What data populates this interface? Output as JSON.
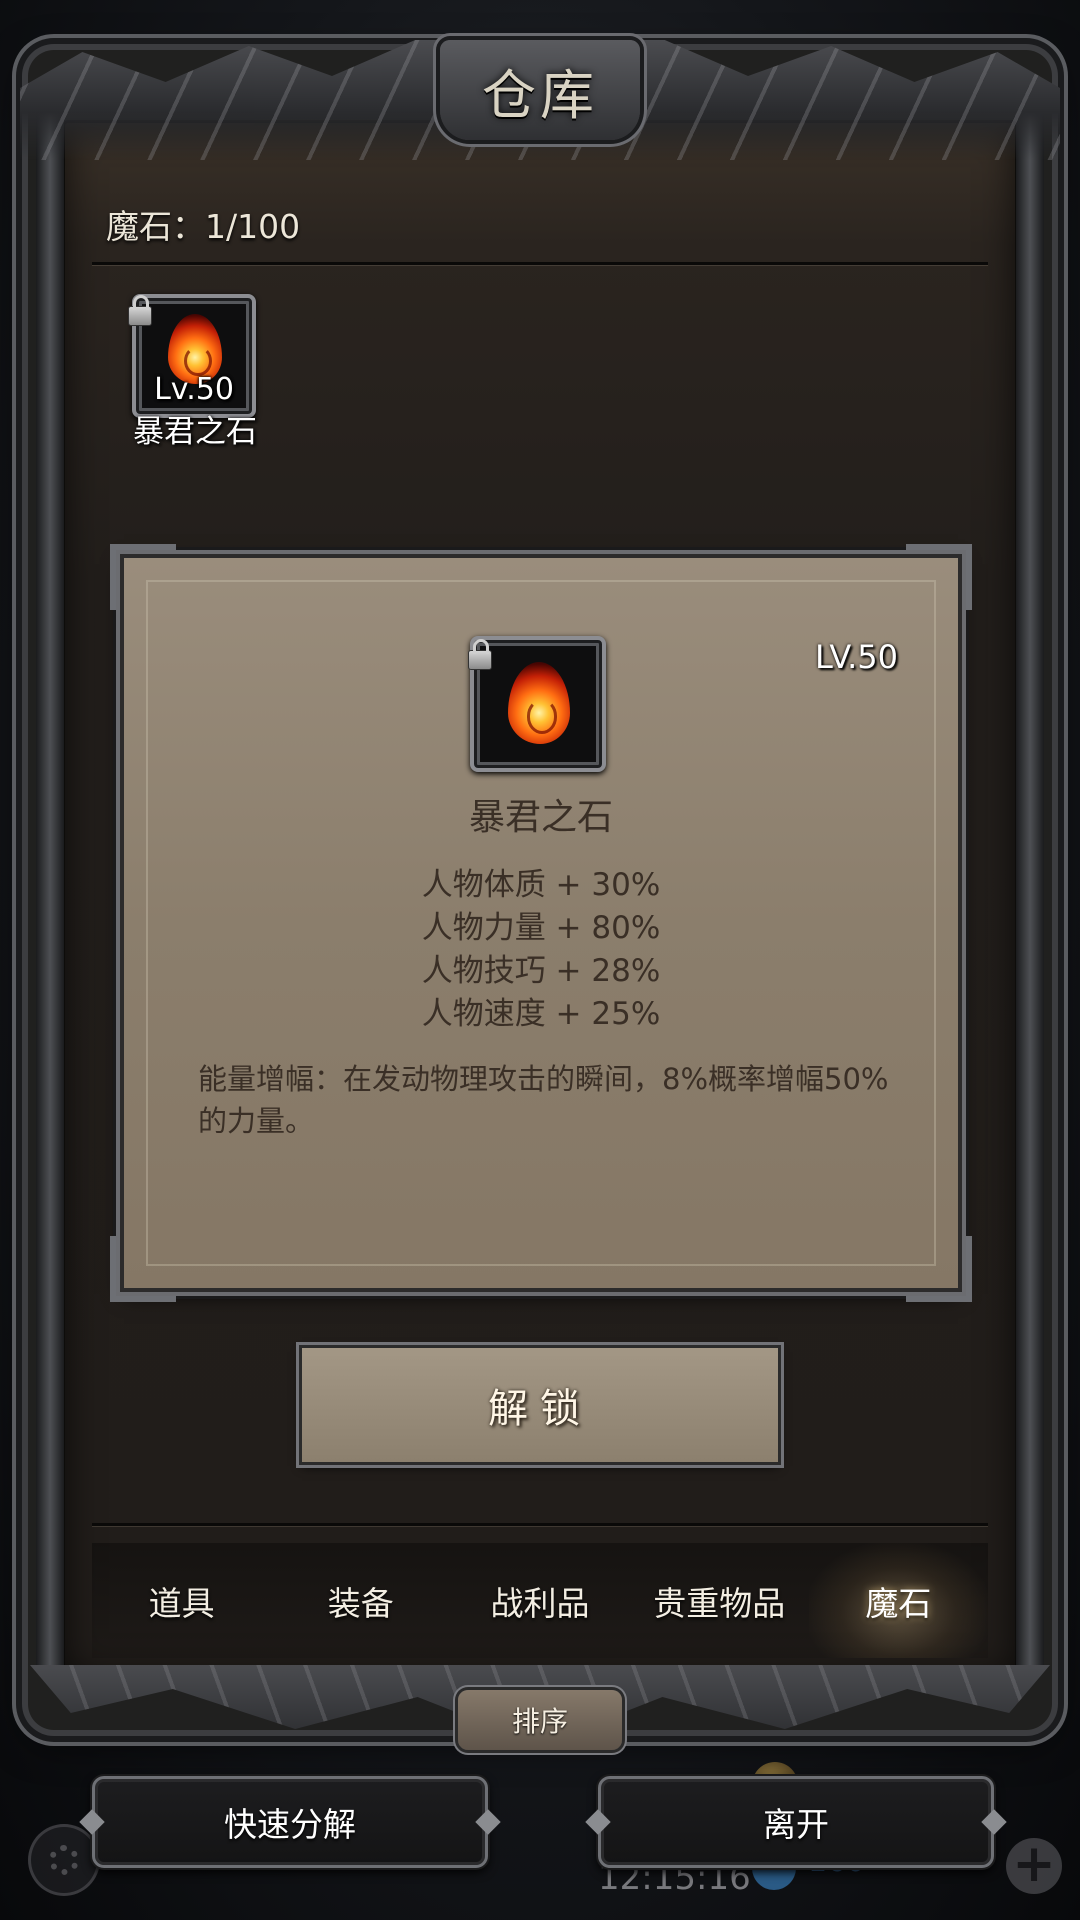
{
  "window": {
    "title": "仓库"
  },
  "capacity": {
    "label": "魔石：1/100"
  },
  "inventory": {
    "items": [
      {
        "name": "暴君之石",
        "level": "Lv.50",
        "locked": true,
        "icon": "fire-stone-icon"
      }
    ]
  },
  "detail": {
    "level": "LV.50",
    "name": "暴君之石",
    "stats": [
      "人物体质 + 30%",
      "人物力量 + 80%",
      "人物技巧 + 28%",
      "人物速度 + 25%"
    ],
    "description": "能量增幅：在发动物理攻击的瞬间，8%概率增幅50%的力量。"
  },
  "unlock_button": "解锁",
  "tabs": [
    {
      "label": "道具",
      "active": false
    },
    {
      "label": "装备",
      "active": false
    },
    {
      "label": "战利品",
      "active": false
    },
    {
      "label": "贵重物品",
      "active": false
    },
    {
      "label": "魔石",
      "active": true
    }
  ],
  "sort_button": "排序",
  "actions": {
    "decompose": "快速分解",
    "leave": "离开"
  },
  "hud": {
    "time": "12:15:16",
    "count": "160"
  },
  "colors": {
    "panel_bg": "#8b7e6c",
    "panel_text": "#3a2f26",
    "frame_metal": "#6e7075",
    "text_light": "#ece6d8"
  }
}
